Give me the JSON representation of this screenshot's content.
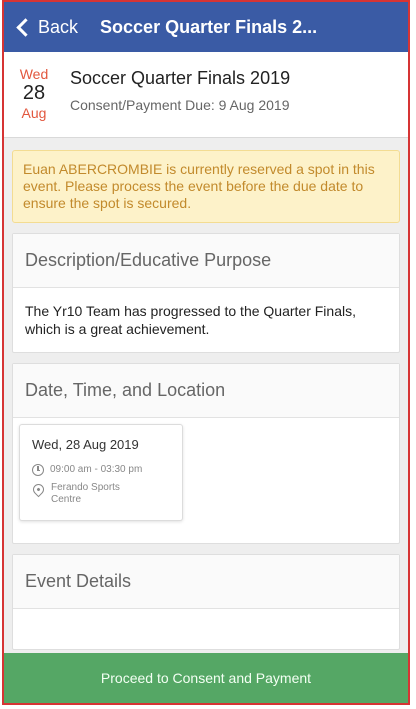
{
  "navbar": {
    "back_label": "Back",
    "title": "Soccer Quarter Finals 2..."
  },
  "event": {
    "weekday": "Wed",
    "day": "28",
    "month": "Aug",
    "title": "Soccer Quarter Finals 2019",
    "due_label": "Consent/Payment Due:",
    "due_date": "9 Aug 2019"
  },
  "alert": {
    "text": "Euan ABERCROMBIE is currently reserved a spot in this event. Please process the event before the due date to ensure the spot is secured."
  },
  "description": {
    "header": "Description/Educative Purpose",
    "body": "The Yr10 Team has progressed to the Quarter Finals, which is a great achievement."
  },
  "location": {
    "header": "Date, Time, and Location",
    "date": "Wed, 28 Aug 2019",
    "time": "09:00 am - 03:30 pm",
    "place": "Ferando Sports Centre"
  },
  "event_details": {
    "header": "Event Details"
  },
  "cta": {
    "label": "Proceed to Consent and Payment"
  },
  "colors": {
    "nav": "#3a5ba5",
    "accent_red": "#e2573e",
    "cta": "#55a765",
    "alert_bg": "#fdf2c9",
    "alert_text": "#c28a2c"
  }
}
